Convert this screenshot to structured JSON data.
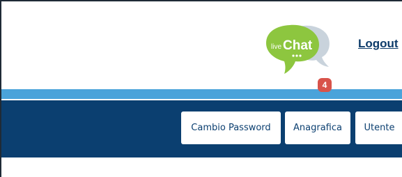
{
  "header": {
    "livechat_logo": {
      "text_small": "live",
      "text_big": "Chat",
      "colors": {
        "bubble_front": "#8dc63f",
        "bubble_back": "#c9d3dc"
      }
    },
    "logout_label": "Logout",
    "chat_badge_count": "4"
  },
  "nav": {
    "buttons": [
      {
        "label": "Cambio Password"
      },
      {
        "label": "Anagrafica"
      },
      {
        "label": "Utente"
      }
    ]
  },
  "colors": {
    "stripe": "#4aa3da",
    "navbar": "#0b3f70",
    "logout": "#0d3b6a",
    "badge": "#d8534a"
  }
}
